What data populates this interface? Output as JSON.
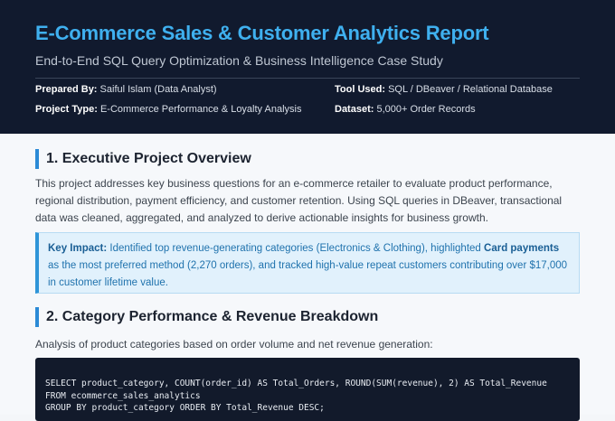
{
  "header": {
    "title": "E-Commerce Sales & Customer Analytics Report",
    "subtitle": "End-to-End SQL Query Optimization & Business Intelligence Case Study",
    "meta": {
      "prepared_by_label": "Prepared By:",
      "prepared_by_value": "Saiful Islam (Data Analyst)",
      "tool_label": "Tool Used:",
      "tool_value": "SQL / DBeaver / Relational Database",
      "project_type_label": "Project Type:",
      "project_type_value": "E-Commerce Performance & Loyalty Analysis",
      "dataset_label": "Dataset:",
      "dataset_value": "5,000+ Order Records"
    }
  },
  "section1": {
    "title": "1. Executive Project Overview",
    "paragraph": "This project addresses key business questions for an e-commerce retailer to evaluate product performance, regional distribution, payment efficiency, and customer retention. Using SQL queries in DBeaver, transactional data was cleaned, aggregated, and analyzed to derive actionable insights for business growth.",
    "callout": {
      "label": "Key Impact:",
      "text_before": "Identified top revenue-generating categories (Electronics & Clothing), highlighted",
      "emphasis": "Card payments",
      "text_after": "as the most preferred method (2,270 orders), and tracked high-value repeat customers contributing over $17,000 in customer lifetime value."
    }
  },
  "section2": {
    "title": "2. Category Performance & Revenue Breakdown",
    "paragraph": "Analysis of product categories based on order volume and net revenue generation:",
    "code": {
      "line1": "SELECT product_category, COUNT(order_id) AS Total_Orders, ROUND(SUM(revenue), 2) AS Total_Revenue",
      "line2": "FROM ecommerce_sales_analytics",
      "line3": "GROUP BY product_category ORDER BY Total_Revenue DESC;"
    }
  }
}
